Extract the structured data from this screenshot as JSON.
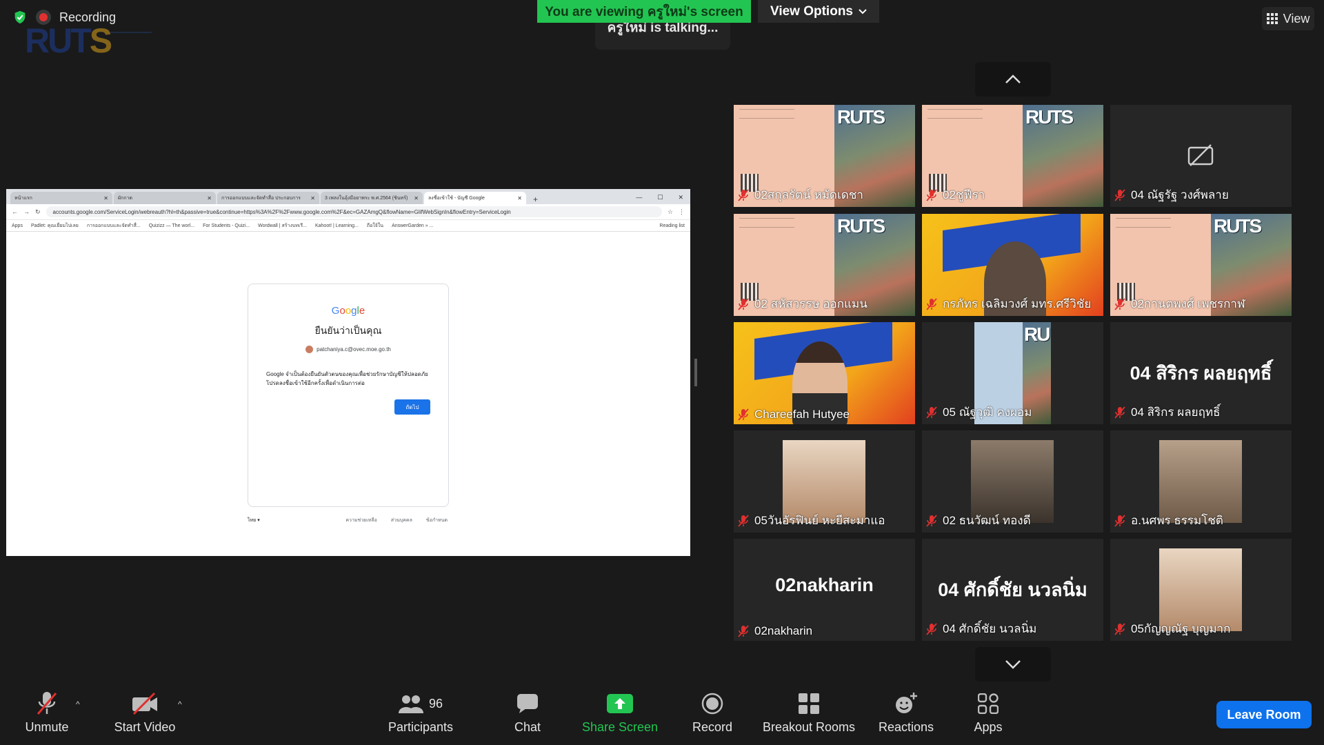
{
  "top": {
    "recording_label": "Recording",
    "logo_text_a": "RUT",
    "logo_text_b": "S",
    "viewing_banner": "You are viewing ครูใหม่'s screen",
    "view_options_label": "View Options",
    "talking_text": "ครูใหม่ is talking...",
    "view_label": "View"
  },
  "shared_screen": {
    "tabs": [
      {
        "label": "หน้าแรก",
        "active": false
      },
      {
        "label": "ผักกาด",
        "active": false
      },
      {
        "label": "การออกแบบและจัดทำสื่อ ประกอบการ",
        "active": false
      },
      {
        "label": "3 เพลงในอุ้งมือยาพระ พ.ศ.2564 (ชินทร์)",
        "active": false
      },
      {
        "label": "ลงชื่อเข้าใช้ - บัญชี Google",
        "active": true
      }
    ],
    "url": "accounts.google.com/ServiceLogin/webreauth?hl=th&passive=true&continue=https%3A%2F%2Fwww.google.com%2F&ec=GAZAmgQ&flowName=GlifWebSignIn&flowEntry=ServiceLogin",
    "bookmarks": [
      "Apps",
      "Padlet: คุณเยี่ยมไปเลย",
      "การออกแบบและจัดทำสื่...",
      "Quizizz — The worl...",
      "For Students - Quizi...",
      "Wordwall | สร้างบทเรี...",
      "Kahoot! | Learning...",
      "ถือใจ้ใน",
      "AnswerGarden » ..."
    ],
    "reading_list": "Reading list",
    "google_logo": [
      "G",
      "o",
      "o",
      "g",
      "l",
      "e"
    ],
    "title": "ยืนยันว่าเป็นคุณ",
    "email": "patchaniya.c@ovec.moe.go.th",
    "body": "Google จำเป็นต้องยืนยันตัวตนของคุณเพื่อช่วยรักษาบัญชีให้ปลอดภัย โปรดลงชื่อเข้าใช้อีกครั้งเพื่อดำเนินการต่อ",
    "next_button": "ถัดไป",
    "footer_lang": "ไทย",
    "footer_links": [
      "ความช่วยเหลือ",
      "ส่วนบุคคล",
      "ข้อกำหนด"
    ]
  },
  "gallery": {
    "tiles": [
      {
        "name": "02สกุลรัตน์ หมัดเดชา",
        "kind": "slide"
      },
      {
        "name": "02ชูฟีรา",
        "kind": "slide"
      },
      {
        "name": "04 ณัฐรัฐ วงศ์พลาย",
        "kind": "camoff"
      },
      {
        "name": "02 สหัสวรรษ ออกแมน",
        "kind": "slide"
      },
      {
        "name": "กรภัทร เฉลิมวงศ์ มทร.ศรีวิชัย",
        "kind": "banner"
      },
      {
        "name": "02กานตพงศ์ เพชรกาฬ",
        "kind": "slide"
      },
      {
        "name": "Chareefah Hutyee",
        "kind": "banner-person"
      },
      {
        "name": "05 ณัฐวุฒิ คงผอม",
        "kind": "slide-narrow"
      },
      {
        "name": "04 สิริกร ผลยฤทธิ์",
        "kind": "bigname",
        "big": "04 สิริกร ผลยฤทธิ์"
      },
      {
        "name": "05วันอัรฟินย์ หะยีสะมาแอ",
        "kind": "photo"
      },
      {
        "name": "02 ธนวัฒน์ ทองดี",
        "kind": "photo"
      },
      {
        "name": "อ.นศพร ธรรมโชติ",
        "kind": "photo"
      },
      {
        "name": "02nakharin",
        "kind": "bigname",
        "big": "02nakharin"
      },
      {
        "name": "04 ศักดิ์ชัย นวลนิ่ม",
        "kind": "bigname",
        "big": "04 ศักดิ์ชัย นวลนิ่ม"
      },
      {
        "name": "05กัญญณัฐ บุญมาก",
        "kind": "photo"
      }
    ]
  },
  "toolbar": {
    "unmute": "Unmute",
    "start_video": "Start Video",
    "participants": "Participants",
    "participants_count": "96",
    "chat": "Chat",
    "share_screen": "Share Screen",
    "record": "Record",
    "breakout_rooms": "Breakout Rooms",
    "reactions": "Reactions",
    "apps": "Apps",
    "leave_room": "Leave Room"
  },
  "colors": {
    "accent_green": "#23c552",
    "leave_blue": "#0e72ed",
    "mute_red": "#e0302f"
  }
}
